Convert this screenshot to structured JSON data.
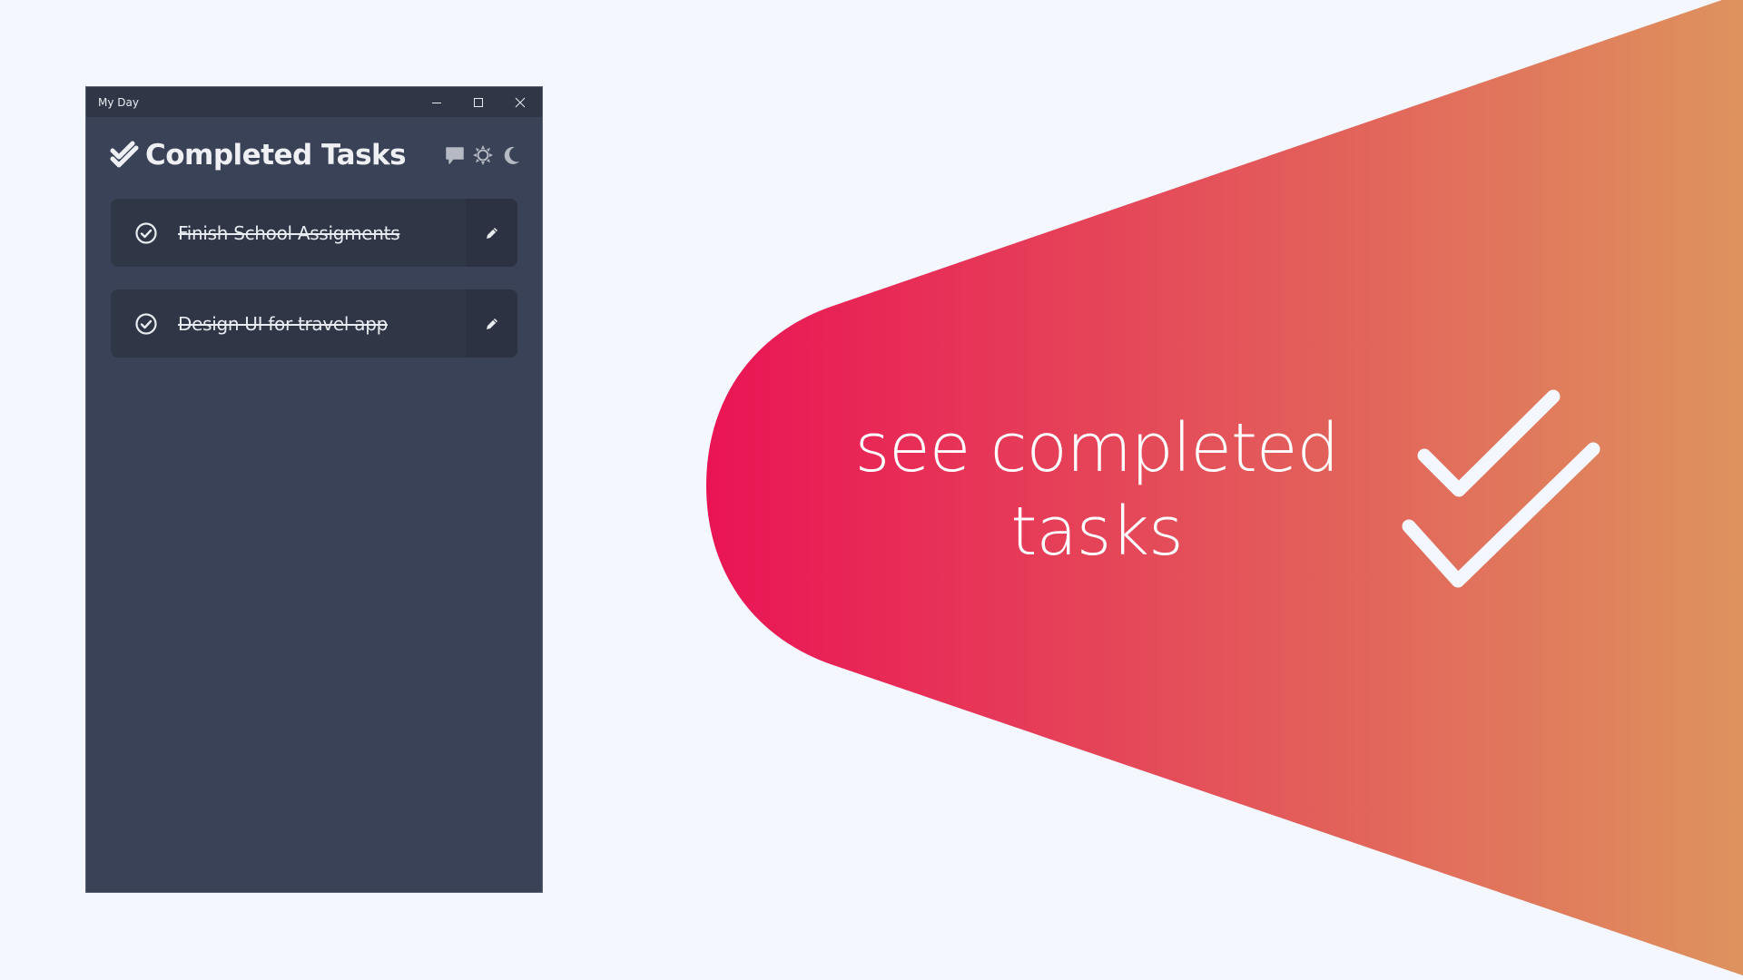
{
  "window": {
    "title": "My Day",
    "controls": {
      "minimize": "minimize",
      "maximize": "maximize",
      "close": "close"
    }
  },
  "header": {
    "title": "Completed Tasks",
    "icons": [
      "double-check-icon",
      "feedback-icon",
      "sun-icon",
      "moon-icon"
    ]
  },
  "tasks": [
    {
      "label": "Finish School Assigments",
      "completed": true
    },
    {
      "label": "Design UI for travel app",
      "completed": true
    }
  ],
  "hero": {
    "line1": "see completed",
    "line2": "tasks",
    "gradient_start": "#ea1455",
    "gradient_end": "#de935e"
  },
  "colors": {
    "page_bg": "#f4f8fe",
    "window_bg": "#394256",
    "titlebar_bg": "#2f3646",
    "task_bg": "#2f3646"
  }
}
